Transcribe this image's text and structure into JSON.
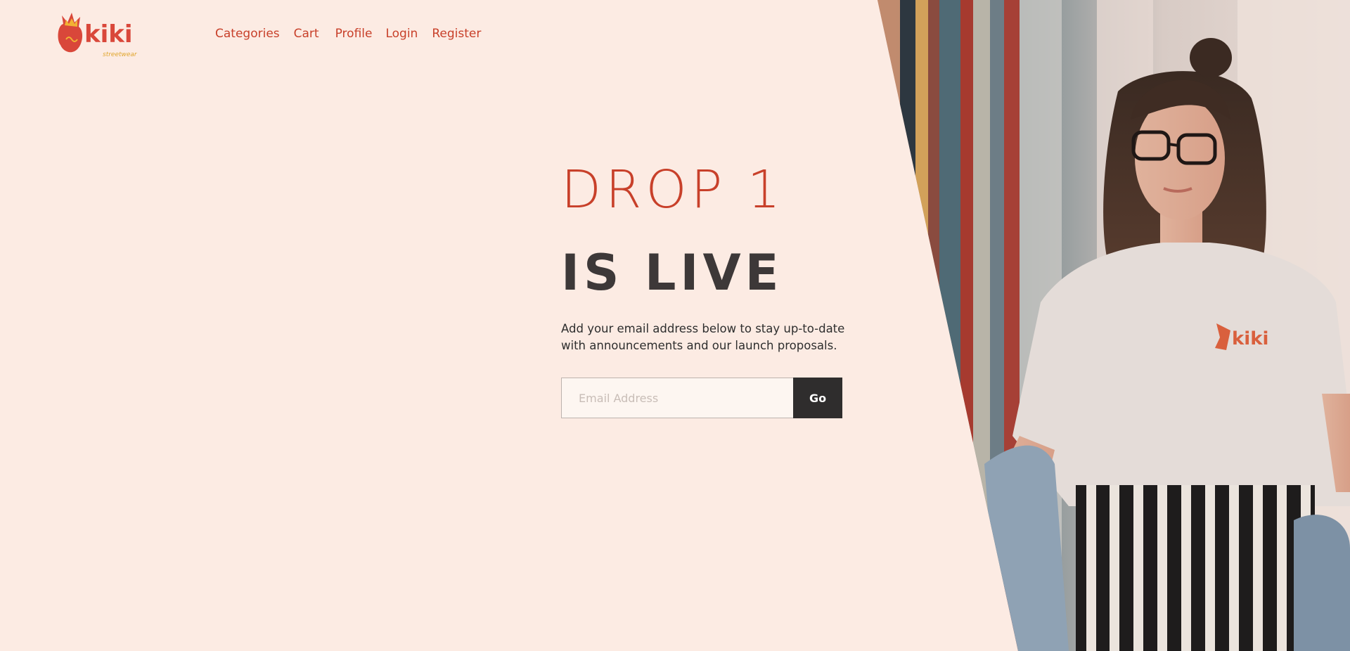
{
  "brand": {
    "name": "kiki",
    "tagline": "streetwear",
    "primary_color": "#c8402a",
    "accent_color": "#f2b233"
  },
  "nav": {
    "categories": "Categories",
    "cart": "Cart",
    "profile": "Profile",
    "login": "Login",
    "register": "Register"
  },
  "hero": {
    "line1": "DROP 1",
    "line2": "IS LIVE",
    "blurb": "Add your email address below to stay up-to-date with announcements and our launch proposals.",
    "email_placeholder": "Email Address",
    "go_label": "Go"
  },
  "photo": {
    "icon": "model-photo",
    "shirt_logo": "kiki"
  },
  "colors": {
    "background": "#fcebe3",
    "dark": "#2f2d2d",
    "headline_dark": "#3d3838"
  }
}
